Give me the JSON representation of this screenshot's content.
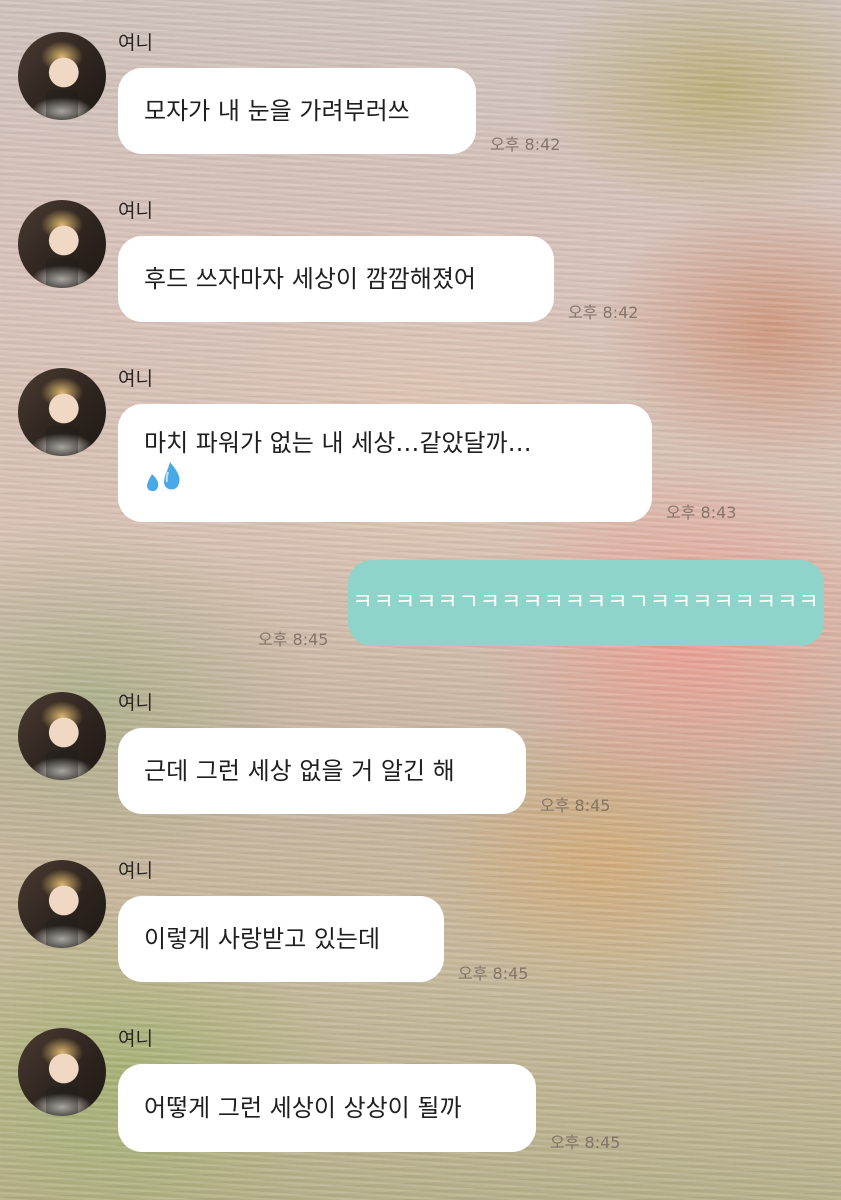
{
  "sender_name": "여니",
  "messages": [
    {
      "text": "모자가 내 눈을 가려부러쓰",
      "time": "오후 8:42"
    },
    {
      "text": "후드 쓰자마자 세상이 깜깜해졌어",
      "time": "오후 8:42"
    },
    {
      "text": "마치 파워가 없는 내 세상…같았달까…",
      "emoji": "sweat-droplets-icon",
      "time": "오후 8:43"
    },
    {
      "text": "ㅋㅋㅋㅋㅋㄱㅋㅋㅋㅋㅋㅋㅋㄱㅋㅋㅋㅋㅋㅋㅋㅋ",
      "time": "오후 8:45",
      "mine": true
    },
    {
      "text": "근데 그런 세상 없을 거 알긴 해",
      "time": "오후 8:45"
    },
    {
      "text": "이렇게 사랑받고 있는데",
      "time": "오후 8:45"
    },
    {
      "text": "어떻게 그런 세상이 상상이 될까",
      "time": "오후 8:45"
    }
  ],
  "colors": {
    "incoming_bubble": "#ffffff",
    "outgoing_bubble": "#8ed4cb",
    "emoji_blue": "#4aa8e8"
  }
}
